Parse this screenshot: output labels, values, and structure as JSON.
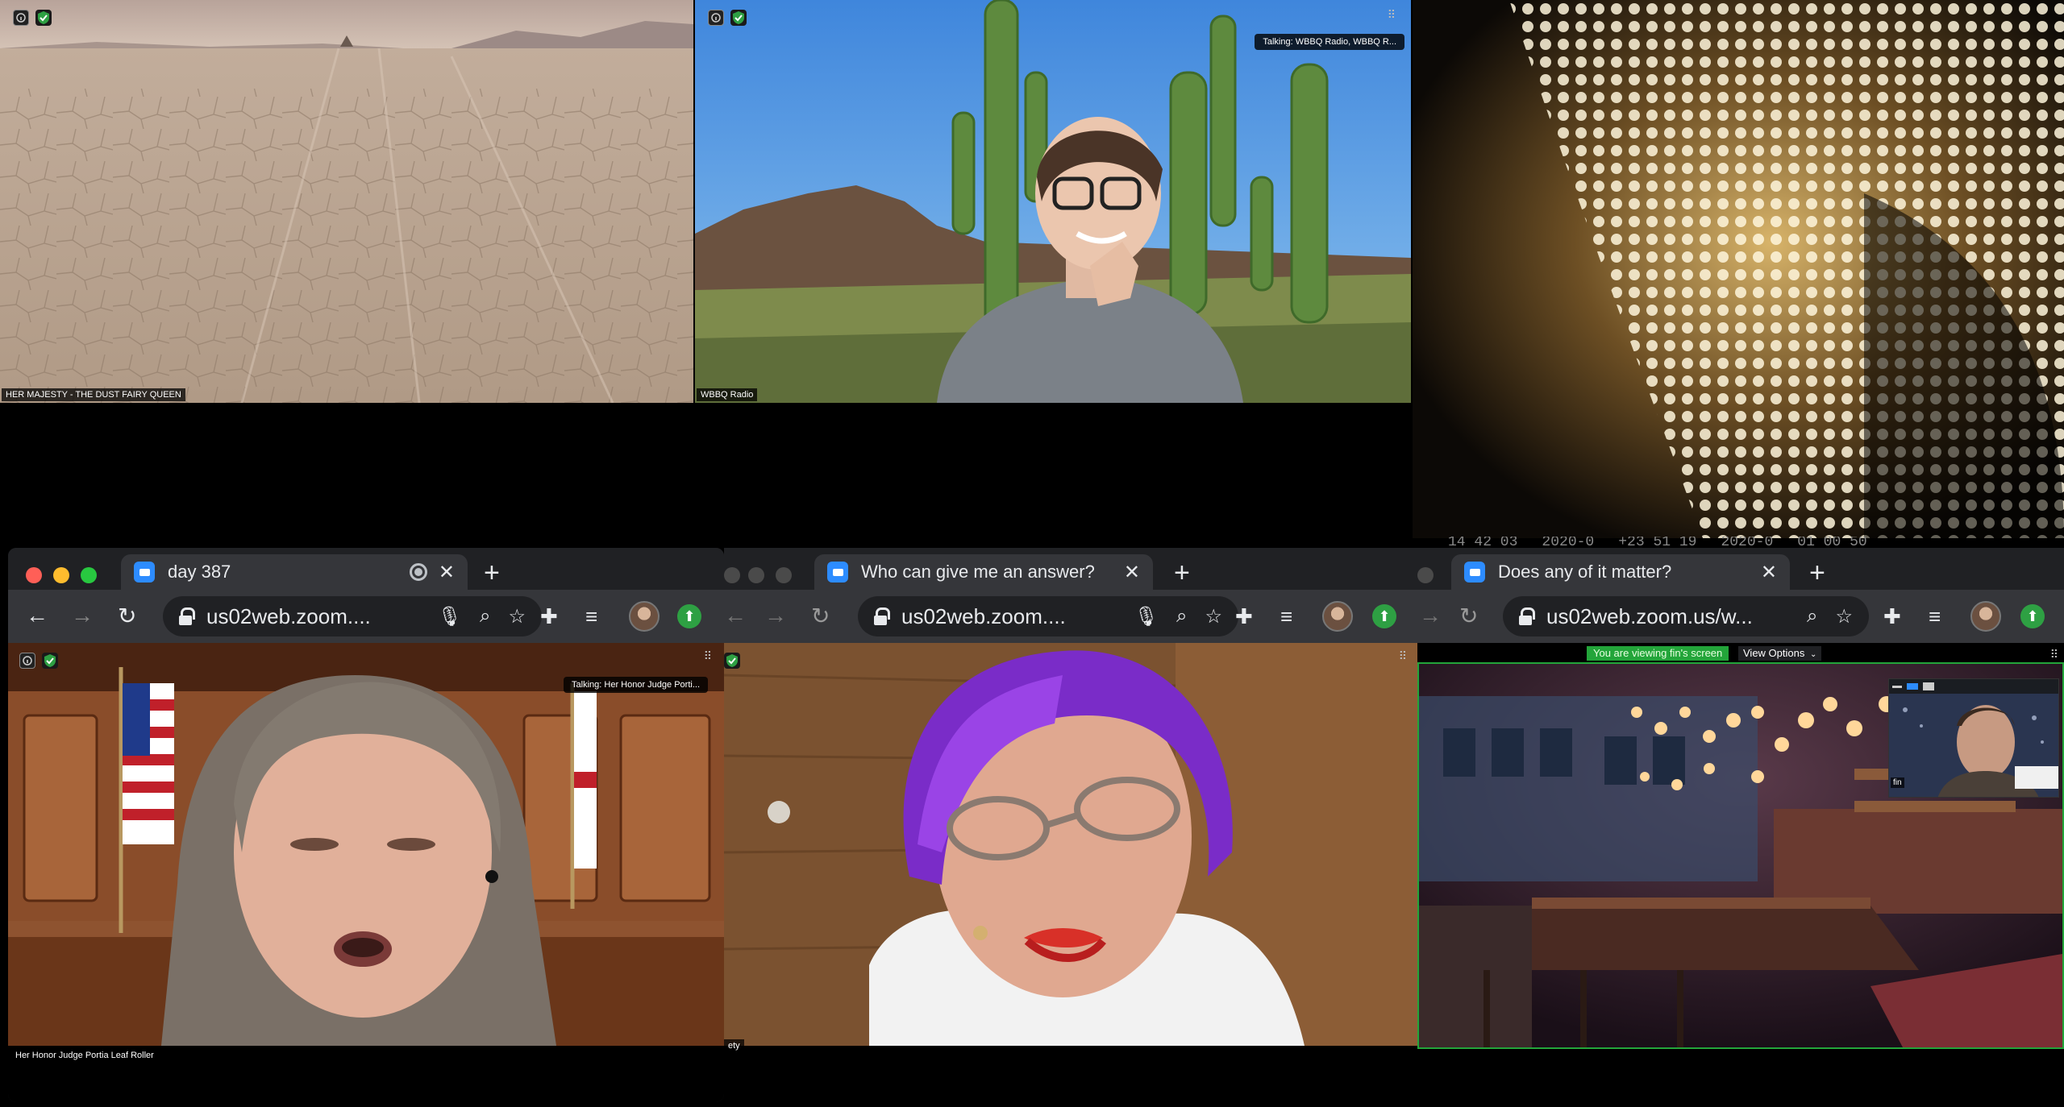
{
  "tiles": {
    "dust_queen": {
      "label": "HER MAJESTY - THE DUST FAIRY QUEEN"
    },
    "wbbq": {
      "label": "WBBQ Radio",
      "talking": "Talking: WBBQ Radio, WBBQ R..."
    }
  },
  "timestamps": [
    "14 42 03",
    "2020-0",
    "+23 51 19",
    "2020-0",
    "01 00 50"
  ],
  "windows": [
    {
      "tab_title": "day 387",
      "url": "us02web.zoom....",
      "talking": "Talking: Her Honor Judge Porti...",
      "participant": "Her Honor Judge Portia Leaf Roller"
    },
    {
      "tab_title": "Who can give me an answer?",
      "url": "us02web.zoom....",
      "participant_partial": "ety"
    },
    {
      "tab_title": "Does any of it matter?",
      "url": "us02web.zoom.us/w...",
      "viewing_banner": "You are viewing fin's screen",
      "view_options": "View Options",
      "thumb_name": "fin"
    }
  ],
  "colors": {
    "zoom_blue": "#2d8cff",
    "chrome_dark": "#202124",
    "chrome_toolbar": "#35363a",
    "share_green": "#23a53a"
  }
}
